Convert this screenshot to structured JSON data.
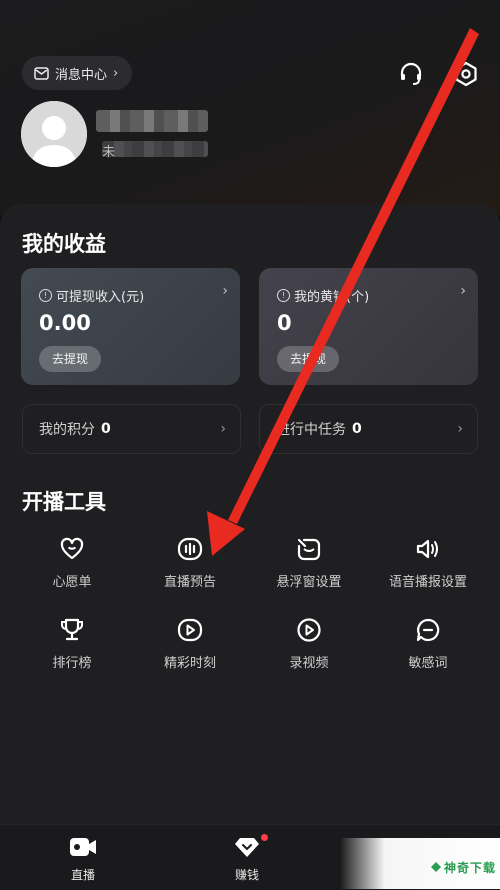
{
  "header": {
    "message_center_label": "消息中心",
    "chevron": "›"
  },
  "profile": {
    "nickname_fragment": "未",
    "avatar_icon": "default-user-avatar"
  },
  "earnings": {
    "title": "我的收益",
    "withdrawable": {
      "label": "可提现收入(元)",
      "value": "0.00",
      "button": "去提现"
    },
    "coins": {
      "label": "我的黄钻(个)",
      "value": "0",
      "button": "去提现"
    },
    "points": {
      "label": "我的积分",
      "value": "0"
    },
    "tasks": {
      "label": "进行中任务",
      "value": "0"
    }
  },
  "tools": {
    "title": "开播工具",
    "items": [
      {
        "label": "心愿单",
        "icon": "heart-icon"
      },
      {
        "label": "直播预告",
        "icon": "live-preview-icon"
      },
      {
        "label": "悬浮窗设置",
        "icon": "floating-window-icon"
      },
      {
        "label": "语音播报设置",
        "icon": "speaker-icon"
      },
      {
        "label": "排行榜",
        "icon": "trophy-icon"
      },
      {
        "label": "精彩时刻",
        "icon": "highlight-play-icon"
      },
      {
        "label": "录视频",
        "icon": "record-video-icon"
      },
      {
        "label": "敏感词",
        "icon": "chat-bubble-icon"
      }
    ]
  },
  "bottom_nav": {
    "tabs": [
      {
        "label": "直播",
        "icon": "live-camera-icon"
      },
      {
        "label": "赚钱",
        "icon": "earn-money-icon"
      }
    ]
  },
  "watermark": {
    "text": "神奇下载"
  },
  "colors": {
    "background": "#141416",
    "sheet": "#1f1f22",
    "card_left": "#3b4148",
    "card_right": "#3b3a42",
    "annotation_arrow": "#e82a20",
    "notification_dot": "#ff3b4a"
  }
}
